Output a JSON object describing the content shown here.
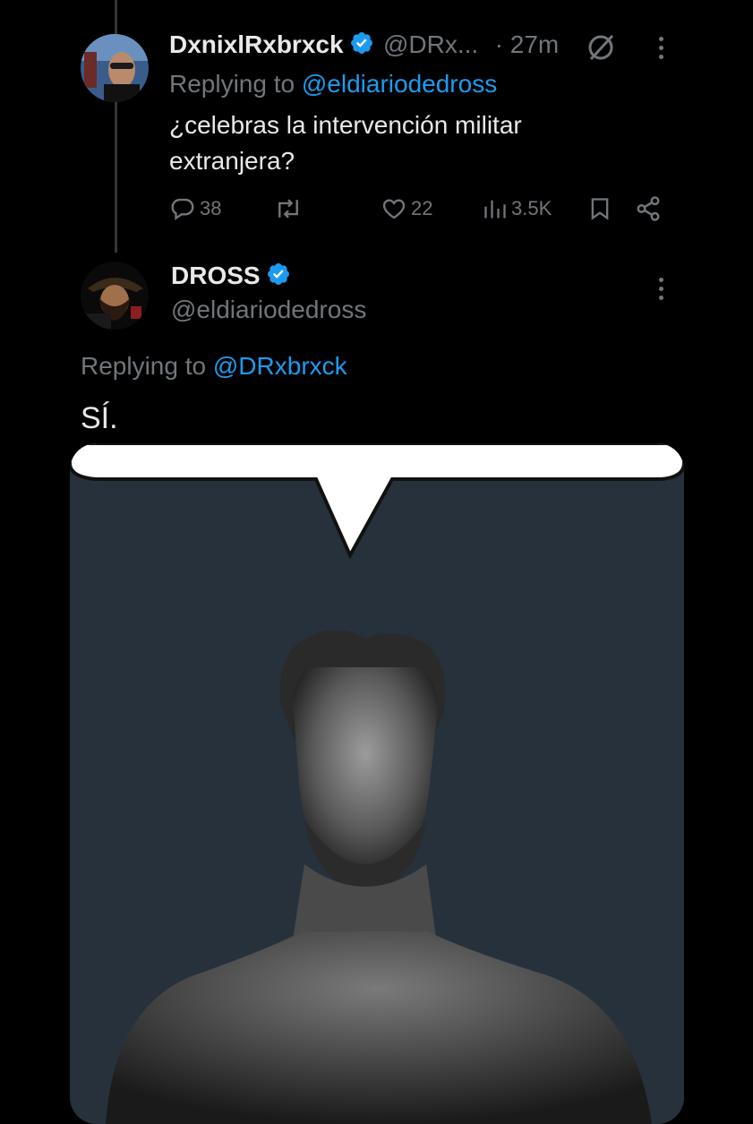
{
  "reply_tweet": {
    "display_name": "DxnixlRxbrxck",
    "handle": "@DRx...",
    "time": "· 27m",
    "replying_label": "Replying to",
    "replying_to": "@eldiariodedross",
    "text_line1": "¿celebras la intervención militar",
    "text_line2": "extranjera?",
    "actions": {
      "replies": "38",
      "likes": "22",
      "views": "3.5K"
    }
  },
  "main_tweet": {
    "display_name": "DROSS",
    "handle": "@eldiariodedross",
    "replying_label": "Replying to",
    "replying_to": "@DRxbrxck",
    "text": "SÍ."
  },
  "colors": {
    "background": "#000000",
    "text": "#e7e9ea",
    "muted": "#71767b",
    "accent": "#1d9bf0"
  },
  "icons": [
    "verified-badge-icon",
    "grok-icon",
    "more-icon",
    "reply-icon",
    "retweet-icon",
    "like-icon",
    "views-icon",
    "bookmark-icon",
    "share-icon"
  ]
}
